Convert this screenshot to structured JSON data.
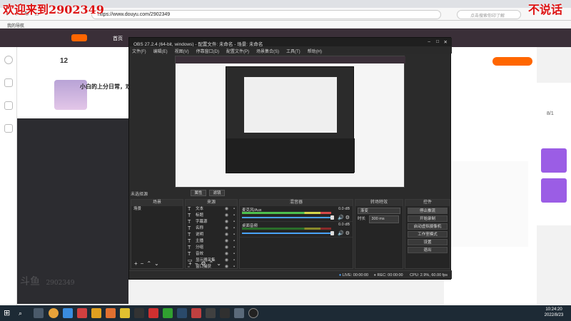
{
  "overlay": {
    "left": "欢迎来到2902349",
    "right": "不说话"
  },
  "browser": {
    "url": "https://www.douyu.com/2902349",
    "search_placeholder": "点击搜索你印了解",
    "bookmark": "我的导航"
  },
  "douyu": {
    "nav_home": "首页",
    "room_number": "12",
    "room_title": "小白的上分日常，欢",
    "sidebar_counts": "8/1",
    "watermark": "斗鱼",
    "watermark_id": "2902349"
  },
  "obs": {
    "title": "OBS 27.2.4 (64-bit, windows) - 配置文件: 未命名 - 场景: 未命名",
    "menu": [
      "文件(F)",
      "编辑(E)",
      "视图(V)",
      "停靠窗口(D)",
      "配置文件(P)",
      "场景集合(S)",
      "工具(T)",
      "帮助(H)"
    ],
    "source_selected": "未选择源",
    "props_btn": "属性",
    "filter_btn": "滤镜",
    "docks": {
      "scenes": "场景",
      "sources": "来源",
      "mixer": "混音器",
      "transitions": "转场特效",
      "controls": "控件"
    },
    "scenes": [
      "场景"
    ],
    "sources": [
      "文本",
      "标题",
      "字幕源",
      "名称",
      "说明",
      "主播",
      "分组",
      "音效",
      "显示器采集",
      "窗口捕获"
    ],
    "mixer": [
      {
        "name": "麦克风/Aux",
        "db": "0.0 dB"
      },
      {
        "name": "桌面音频",
        "db": "0.0 dB"
      }
    ],
    "transition": {
      "type": "渐变",
      "duration_label": "时长",
      "duration": "300 ms"
    },
    "controls": [
      "停止推流",
      "开始录制",
      "启动虚拟摄像机",
      "工作室模式",
      "设置",
      "退出"
    ],
    "status": {
      "live": "LIVE: 00:00:00",
      "rec": "REC: 00:00:00",
      "cpu": "CPU: 2.9%, 60.00 fps"
    }
  },
  "clock": {
    "time": "10:24:20",
    "date": "2022/8/23"
  }
}
